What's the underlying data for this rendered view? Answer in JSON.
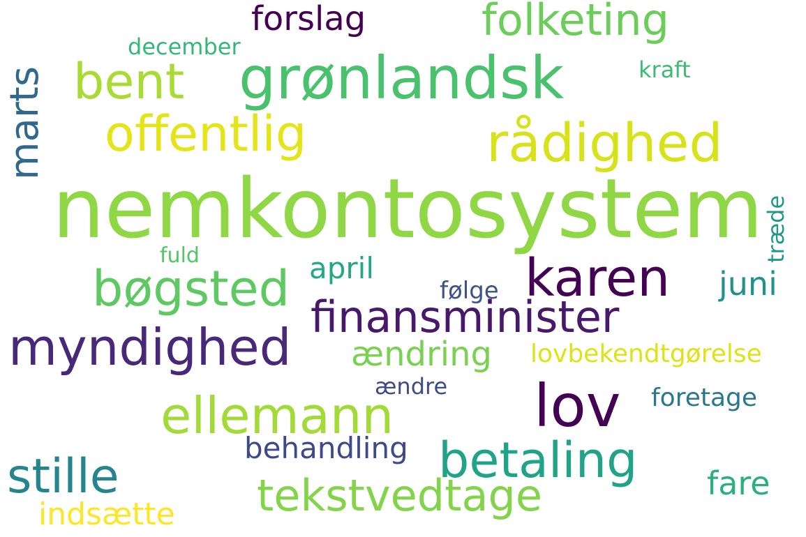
{
  "words": {
    "nemkontosystem": {
      "text": "nemkontosystem",
      "color": "#8fd744"
    },
    "gronlandsk": {
      "text": "grønlandsk",
      "color": "#4ac16d"
    },
    "radighed": {
      "text": "rådighed",
      "color": "#d8e219"
    },
    "bent": {
      "text": "bent",
      "color": "#a8db34"
    },
    "offentlig": {
      "text": "offentlig",
      "color": "#e5e419"
    },
    "marts": {
      "text": "marts",
      "color": "#31688e"
    },
    "folketing": {
      "text": "folketing",
      "color": "#6ccd5a"
    },
    "forslag": {
      "text": "forslag",
      "color": "#440154"
    },
    "december": {
      "text": "december",
      "color": "#35b779"
    },
    "kraft": {
      "text": "kraft",
      "color": "#3cbb75"
    },
    "karen": {
      "text": "karen",
      "color": "#440154"
    },
    "bogsted": {
      "text": "bøgsted",
      "color": "#5ec962"
    },
    "finansminister": {
      "text": "finansminister",
      "color": "#48186a"
    },
    "april": {
      "text": "april",
      "color": "#22a884"
    },
    "fuld": {
      "text": "fuld",
      "color": "#54c568"
    },
    "traede": {
      "text": "træde",
      "color": "#1f988b"
    },
    "folge": {
      "text": "følge",
      "color": "#3b528b"
    },
    "juni": {
      "text": "juni",
      "color": "#21918c"
    },
    "myndighed": {
      "text": "myndighed",
      "color": "#482878"
    },
    "aendring": {
      "text": "ændring",
      "color": "#7ad151"
    },
    "lovbekendtgorelse": {
      "text": "lovbekendtgørelse",
      "color": "#dde318"
    },
    "lov": {
      "text": "lov",
      "color": "#440154"
    },
    "aendre": {
      "text": "ændre",
      "color": "#3e4a89"
    },
    "foretage": {
      "text": "foretage",
      "color": "#2a788e"
    },
    "ellemann": {
      "text": "ellemann",
      "color": "#a2da37"
    },
    "behandling": {
      "text": "behandling",
      "color": "#3e4989"
    },
    "betaling": {
      "text": "betaling",
      "color": "#20a386"
    },
    "stille": {
      "text": "stille",
      "color": "#25858e"
    },
    "tekstvedtage": {
      "text": "tekstvedtage",
      "color": "#84d44b"
    },
    "fare": {
      "text": "fare",
      "color": "#2ab07f"
    },
    "indsaette": {
      "text": "indsætte",
      "color": "#fde725"
    }
  }
}
